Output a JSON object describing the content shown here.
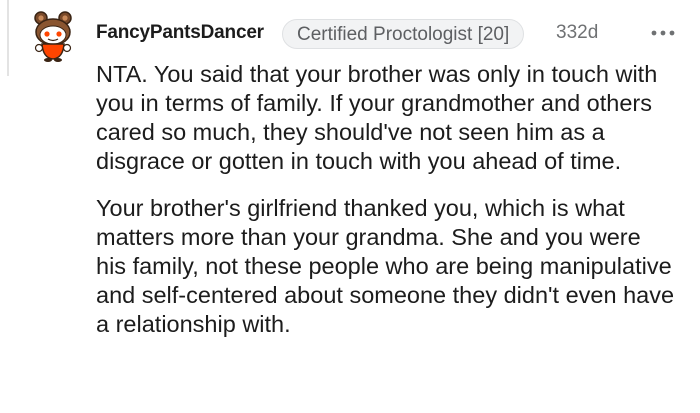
{
  "comment": {
    "author": "FancyPantsDancer",
    "flair": "Certified Proctologist [20]",
    "age": "332d",
    "more_icon": "more-options-icon",
    "avatar_icon": "snoo-avatar-icon",
    "paragraphs": [
      "NTA. You said that your brother was only in touch with you in terms of family. If your grandmother and others cared so much, they should've not seen him as a disgrace or gotten in touch with you ahead of time.",
      "Your brother's girlfriend thanked you, which is what matters more than your grandma. She and you were his family, not these people who are being manipulative and self-centered about someone they didn't even have a relationship with."
    ]
  },
  "colors": {
    "text": "#1c1c1c",
    "meta": "#6f7173",
    "flair_bg": "#f2f3f4",
    "avatar_orange": "#ff4500"
  }
}
